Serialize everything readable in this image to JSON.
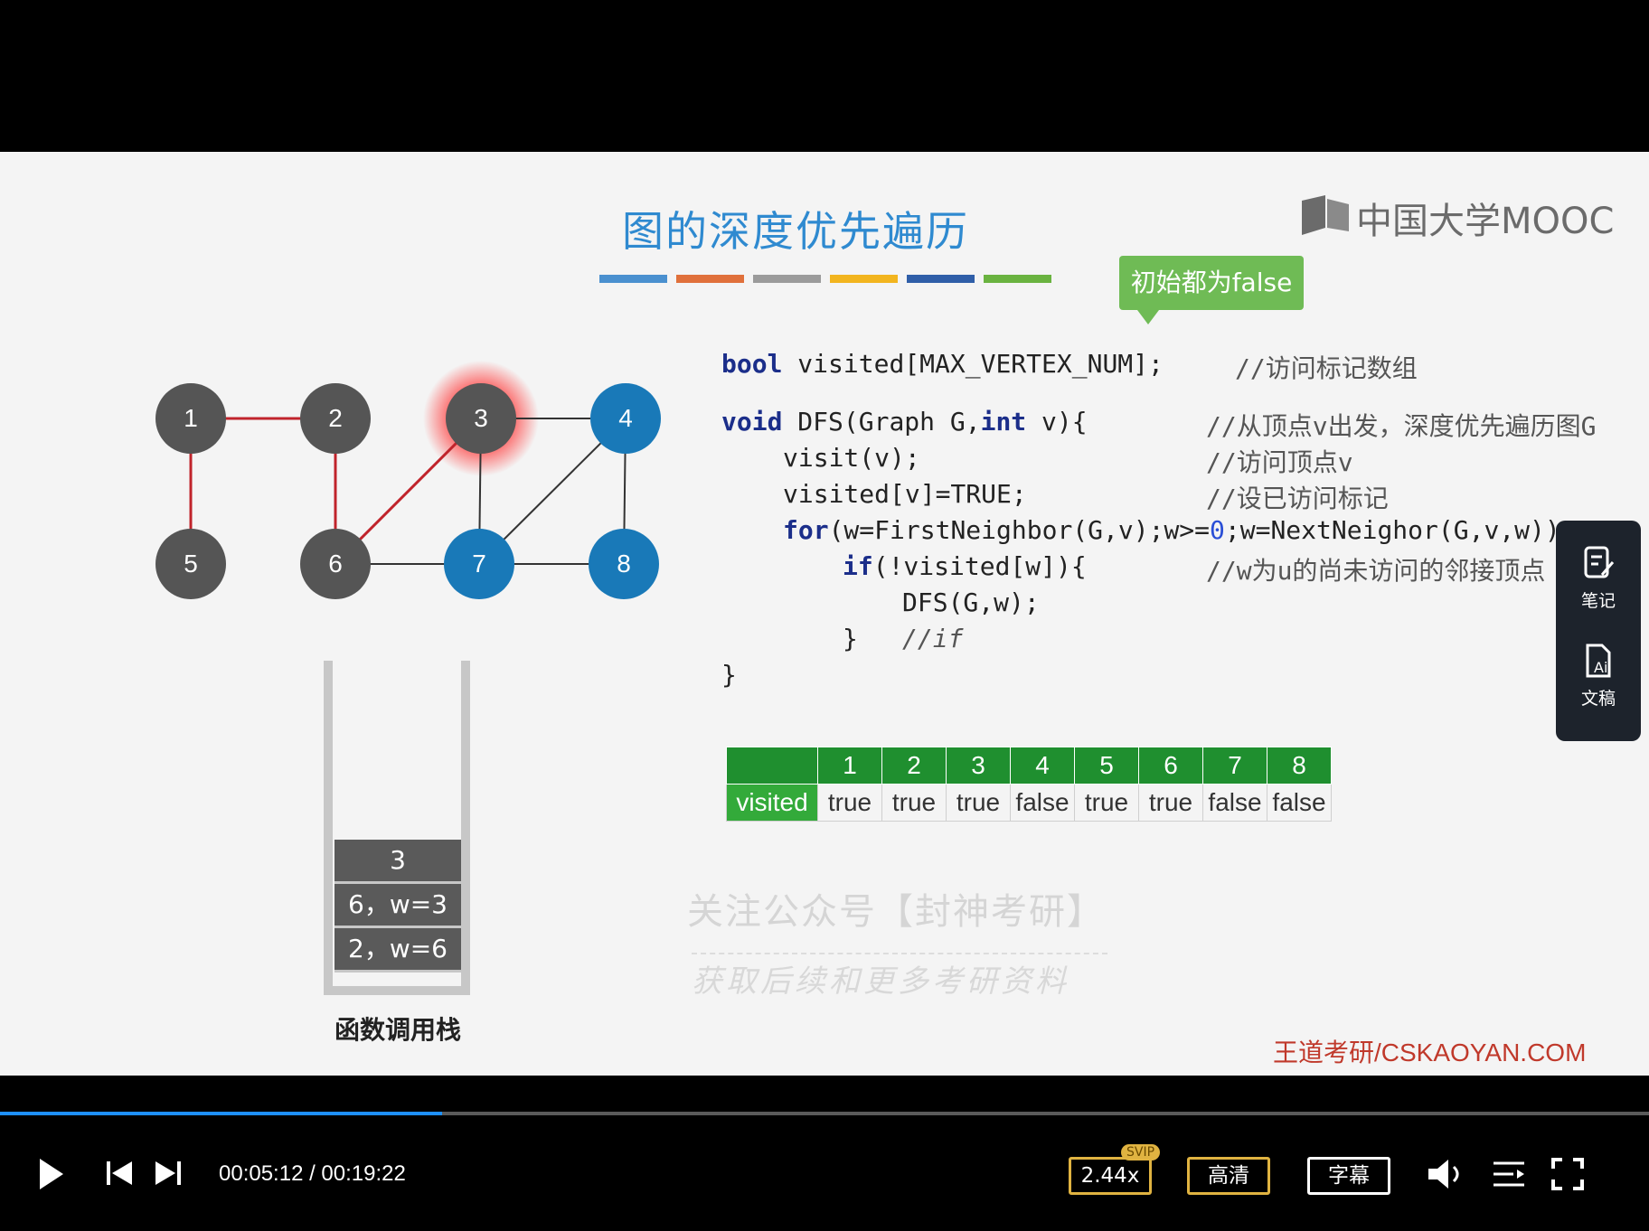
{
  "slide": {
    "title": "图的深度优先遍历",
    "title_bar_colors": [
      "#4a90cf",
      "#e0703b",
      "#9b9b9b",
      "#f2b51f",
      "#2f5ea8",
      "#6ab340"
    ],
    "logo_text": "中国大学MOOC",
    "callout": "初始都为false",
    "watermark_line1": "关注公众号【封神考研】",
    "watermark_line2": "获取后续和更多考研资料",
    "site": "王道考研/CSKAOYAN.COM"
  },
  "graph": {
    "nodes": [
      {
        "id": "1",
        "state": "gray"
      },
      {
        "id": "2",
        "state": "gray"
      },
      {
        "id": "3",
        "state": "gray-highlight"
      },
      {
        "id": "4",
        "state": "blue"
      },
      {
        "id": "5",
        "state": "gray"
      },
      {
        "id": "6",
        "state": "gray"
      },
      {
        "id": "7",
        "state": "blue"
      },
      {
        "id": "8",
        "state": "blue"
      }
    ],
    "edge_color_visited": "#c0232b",
    "edge_color_default": "#333333"
  },
  "code": {
    "line1_kw": "bool",
    "line1_rest": " visited[MAX_VERTEX_NUM];",
    "line1_cm": "//访问标记数组",
    "line2_kw": "void",
    "line2_mid": " DFS(Graph G,",
    "line2_kw2": "int",
    "line2_rest": " v){",
    "line2_cm": "//从顶点v出发，深度优先遍历图G",
    "line3": "visit(v);",
    "line3_cm": "//访问顶点v",
    "line4": "visited[v]=TRUE;",
    "line4_cm": "//设已访问标记",
    "line5_kw": "for",
    "line5_a": "(w=FirstNeighbor(G,v);w>=",
    "line5_num": "0",
    "line5_b": ";w=NextNeighor(G,v,w))",
    "line6_kw": "if",
    "line6_rest": "(!visited[w]){",
    "line6_cm": "//w为u的尚未访问的邻接顶点",
    "line7": "DFS(G,w);",
    "line8": "}",
    "line8_cm": "//if",
    "line9": "}"
  },
  "visited_table": {
    "row_label": "visited",
    "headers": [
      "1",
      "2",
      "3",
      "4",
      "5",
      "6",
      "7",
      "8"
    ],
    "values": [
      "true",
      "true",
      "true",
      "false",
      "true",
      "true",
      "false",
      "false"
    ]
  },
  "stack": {
    "frames": [
      "3",
      "6，w=3",
      "2，w=6"
    ],
    "label": "函数调用栈"
  },
  "side_panel": {
    "notes_label": "笔记",
    "transcript_label": "文稿"
  },
  "player": {
    "time": "00:05:12 / 00:19:22",
    "progress_fraction": 0.268,
    "speed": "2.44x",
    "svip_badge": "SVIP",
    "quality": "高清",
    "subtitles": "字幕"
  }
}
